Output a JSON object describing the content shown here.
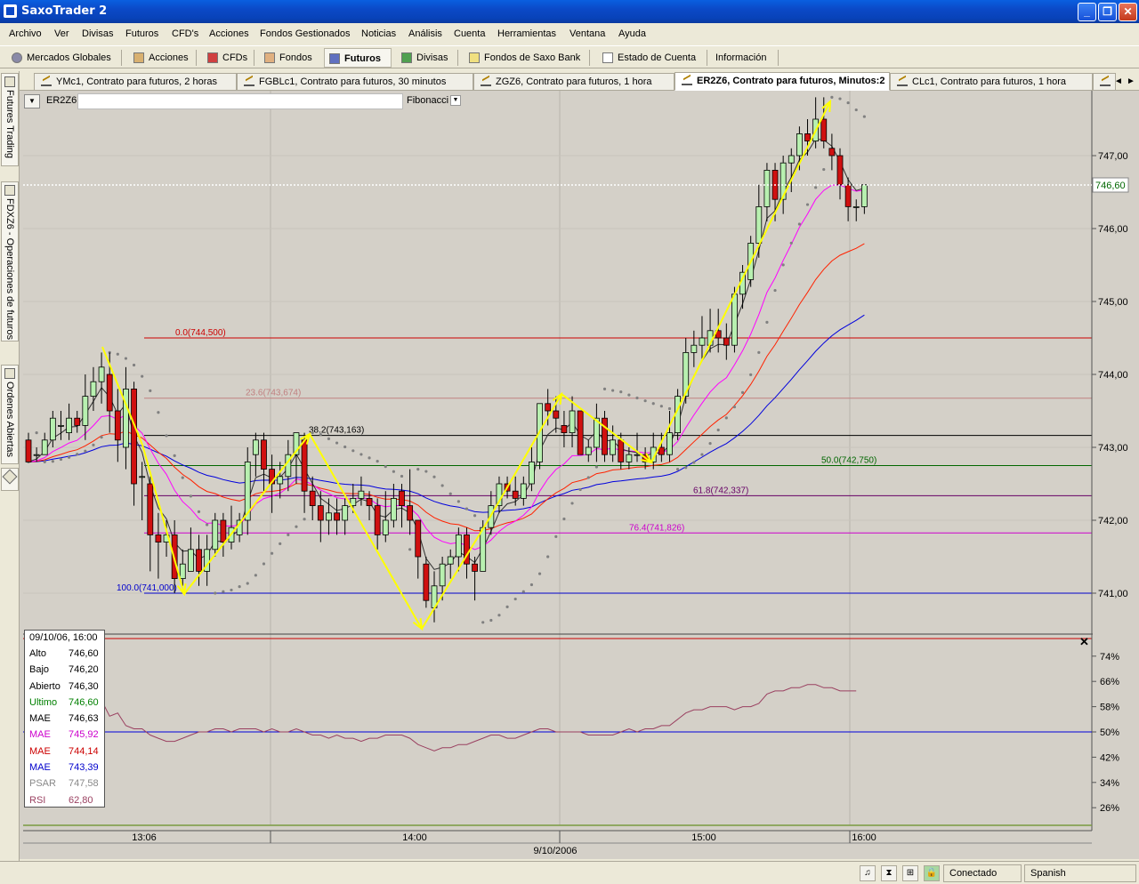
{
  "window": {
    "title": "SaxoTrader 2",
    "minimize": "_",
    "restore": "❐",
    "close": "✕"
  },
  "menu": [
    "Archivo",
    "Ver",
    "Divisas",
    "Futuros",
    "CFD's",
    "Acciones",
    "Fondos Gestionados",
    "Noticias",
    "Análisis",
    "Cuenta",
    "Herramientas",
    "Ventana",
    "Ayuda"
  ],
  "toolbar": [
    "Mercados Globales",
    "Acciones",
    "CFDs",
    "Fondos",
    "Futuros",
    "Divisas",
    "Fondos de Saxo Bank",
    "Estado de Cuenta",
    "Información"
  ],
  "toolbar_active": "Futuros",
  "side_tabs": [
    "Futures Trading",
    "FDXZ6 - Operaciones de futuros",
    "Ordenes Abiertas"
  ],
  "chart_tabs": [
    "YMc1, Contrato para futuros, 2 horas",
    "FGBLc1, Contrato para futuros, 30 minutos",
    "ZGZ6, Contrato para futuros, 1 hora",
    "ER2Z6, Contrato para futuros, Minutos:2",
    "CLc1, Contrato para futuros, 1 hora"
  ],
  "chart_tab_nav": {
    "left": "◄",
    "right": "►"
  },
  "active_chart_tab": 3,
  "chart_header": {
    "symbol": "ER2Z6",
    "study": "Fibonacci"
  },
  "colors": {
    "fib_0": "#cc0000",
    "fib_236": "#c08080",
    "fib_382": "#000000",
    "fib_50": "#006600",
    "fib_618": "#660066",
    "fib_764": "#cc00cc",
    "fib_100": "#0000cc",
    "mae_fast": "#ff00ff",
    "mae_mid": "#ff2200",
    "mae_slow": "#0000dd",
    "psar": "#808080",
    "annotations": "#ffff00",
    "rsi": "#9a4060"
  },
  "fib_levels": [
    {
      "label": "0.0(744,500)",
      "price": 744.5
    },
    {
      "label": "23.6(743,674)",
      "price": 743.674
    },
    {
      "label": "38.2(743,163)",
      "price": 743.163
    },
    {
      "label": "50.0(742,750)",
      "price": 742.75
    },
    {
      "label": "61.8(742,337)",
      "price": 742.337
    },
    {
      "label": "76.4(741,826)",
      "price": 741.826
    },
    {
      "label": "100.0(741,000)",
      "price": 741.0
    }
  ],
  "price_axis": [
    "747,00",
    "746,00",
    "745,00",
    "744,00",
    "743,00",
    "742,00",
    "741,00"
  ],
  "last_price": "746,60",
  "rsi_axis": [
    "74%",
    "66%",
    "58%",
    "50%",
    "42%",
    "34%",
    "26%"
  ],
  "rsi_close": "✕",
  "time_axis": [
    "13:06",
    "14:00",
    "15:00",
    "16:00"
  ],
  "date_label": "9/10/2006",
  "info": {
    "header": "09/10/06, 16:00",
    "rows": [
      {
        "k": "Alto",
        "v": "746,60",
        "color": "#000000"
      },
      {
        "k": "Bajo",
        "v": "746,20",
        "color": "#000000"
      },
      {
        "k": "Abierto",
        "v": "746,30",
        "color": "#000000"
      },
      {
        "k": "Ultimo",
        "v": "746,60",
        "color": "#008000"
      },
      {
        "k": "MAE",
        "v": "746,63",
        "color": "#000000"
      },
      {
        "k": "MAE",
        "v": "745,92",
        "color": "#cc00cc"
      },
      {
        "k": "MAE",
        "v": "744,14",
        "color": "#cc0000"
      },
      {
        "k": "MAE",
        "v": "743,39",
        "color": "#0000cc"
      },
      {
        "k": "PSAR",
        "v": "747,58",
        "color": "#888888"
      },
      {
        "k": "RSI",
        "v": "62,80",
        "color": "#9a4060"
      }
    ]
  },
  "status": {
    "connection": "Conectado",
    "language": "Spanish"
  },
  "chart_data": {
    "type": "candlestick",
    "symbol": "ER2Z6",
    "interval": "2 minutes",
    "y_range": [
      740.4,
      747.8
    ],
    "candles": [
      [
        743.1,
        742.8,
        743.2,
        742.8
      ],
      [
        742.9,
        742.9,
        743.0,
        742.8
      ],
      [
        742.9,
        743.1,
        743.2,
        742.9
      ],
      [
        743.1,
        743.4,
        743.5,
        743.0
      ],
      [
        743.3,
        743.3,
        743.5,
        743.1
      ],
      [
        743.2,
        743.4,
        743.6,
        743.1
      ],
      [
        743.4,
        743.3,
        743.5,
        743.2
      ],
      [
        743.3,
        743.7,
        744.0,
        743.1
      ],
      [
        743.7,
        743.9,
        744.1,
        743.5
      ],
      [
        743.9,
        744.1,
        744.3,
        743.6
      ],
      [
        744.0,
        743.5,
        744.3,
        743.2
      ],
      [
        743.5,
        743.1,
        743.8,
        742.8
      ],
      [
        743.0,
        743.8,
        744.1,
        742.7
      ],
      [
        743.8,
        742.5,
        743.9,
        742.2
      ],
      [
        742.6,
        742.6,
        742.8,
        742.0
      ],
      [
        742.5,
        741.8,
        742.6,
        741.3
      ],
      [
        741.8,
        741.7,
        742.1,
        741.2
      ],
      [
        741.7,
        741.8,
        742.0,
        741.5
      ],
      [
        741.8,
        741.2,
        742.0,
        741.0
      ],
      [
        741.2,
        741.4,
        741.6,
        741.1
      ],
      [
        741.3,
        741.6,
        741.9,
        741.3
      ],
      [
        741.6,
        741.3,
        741.8,
        741.1
      ],
      [
        741.3,
        741.6,
        741.8,
        741.1
      ],
      [
        741.6,
        742.0,
        742.1,
        741.5
      ],
      [
        742.0,
        741.7,
        742.1,
        741.5
      ],
      [
        741.7,
        741.9,
        742.2,
        741.6
      ],
      [
        741.8,
        742.0,
        742.1,
        741.7
      ],
      [
        742.0,
        742.8,
        743.0,
        741.8
      ],
      [
        742.9,
        743.1,
        743.2,
        742.6
      ],
      [
        743.1,
        742.7,
        743.2,
        742.4
      ],
      [
        742.7,
        742.5,
        742.9,
        742.1
      ],
      [
        742.5,
        742.6,
        742.8,
        742.3
      ],
      [
        742.6,
        742.9,
        743.1,
        742.4
      ],
      [
        742.9,
        743.2,
        743.2,
        742.5
      ],
      [
        743.1,
        742.4,
        743.2,
        742.1
      ],
      [
        742.4,
        742.2,
        742.6,
        742.0
      ],
      [
        742.2,
        742.0,
        742.4,
        741.7
      ],
      [
        742.0,
        742.1,
        742.3,
        741.8
      ],
      [
        742.1,
        742.0,
        742.3,
        741.8
      ],
      [
        742.0,
        742.2,
        742.3,
        741.8
      ],
      [
        742.2,
        742.3,
        742.5,
        742.1
      ],
      [
        742.3,
        742.4,
        742.6,
        742.2
      ],
      [
        742.3,
        742.2,
        742.4,
        742.0
      ],
      [
        742.2,
        741.8,
        742.3,
        741.6
      ],
      [
        741.8,
        742.0,
        742.4,
        741.7
      ],
      [
        742.0,
        742.3,
        742.5,
        741.9
      ],
      [
        742.4,
        742.2,
        742.5,
        741.9
      ],
      [
        742.2,
        742.0,
        742.7,
        741.8
      ],
      [
        742.0,
        741.5,
        742.0,
        741.2
      ],
      [
        741.4,
        740.9,
        741.5,
        740.8
      ],
      [
        740.8,
        741.1,
        741.3,
        740.6
      ],
      [
        741.1,
        741.4,
        741.5,
        740.9
      ],
      [
        741.4,
        741.5,
        741.6,
        741.2
      ],
      [
        741.5,
        741.8,
        741.9,
        741.3
      ],
      [
        741.8,
        741.4,
        741.9,
        741.2
      ],
      [
        741.4,
        741.3,
        741.5,
        740.9
      ],
      [
        741.3,
        741.9,
        742.0,
        741.3
      ],
      [
        741.9,
        742.2,
        742.4,
        741.8
      ],
      [
        742.2,
        742.5,
        742.6,
        742.1
      ],
      [
        742.5,
        742.4,
        742.6,
        742.3
      ],
      [
        742.4,
        742.3,
        742.6,
        742.2
      ],
      [
        742.3,
        742.5,
        742.6,
        742.2
      ],
      [
        742.5,
        742.8,
        743.0,
        742.4
      ],
      [
        742.8,
        743.6,
        743.6,
        742.7
      ],
      [
        743.6,
        743.5,
        743.8,
        743.3
      ],
      [
        743.5,
        743.4,
        743.7,
        743.2
      ],
      [
        743.3,
        743.2,
        743.5,
        743.0
      ],
      [
        743.2,
        743.5,
        743.7,
        743.0
      ],
      [
        743.5,
        742.9,
        743.5,
        742.9
      ],
      [
        742.9,
        743.0,
        743.1,
        742.8
      ],
      [
        743.0,
        743.4,
        743.6,
        742.8
      ],
      [
        743.4,
        742.9,
        743.5,
        742.8
      ],
      [
        742.9,
        743.1,
        743.3,
        742.8
      ],
      [
        743.1,
        742.8,
        743.2,
        742.7
      ],
      [
        742.8,
        742.9,
        743.0,
        742.7
      ],
      [
        742.9,
        742.9,
        743.2,
        742.8
      ],
      [
        742.9,
        742.8,
        743.0,
        742.7
      ],
      [
        742.8,
        743.0,
        743.2,
        742.7
      ],
      [
        743.0,
        742.9,
        743.2,
        742.8
      ],
      [
        742.9,
        743.2,
        743.5,
        742.8
      ],
      [
        743.2,
        743.7,
        743.8,
        743.1
      ],
      [
        743.7,
        744.3,
        744.5,
        743.6
      ],
      [
        744.3,
        744.4,
        744.6,
        744.1
      ],
      [
        744.4,
        744.5,
        744.8,
        744.2
      ],
      [
        744.4,
        744.6,
        744.9,
        744.3
      ],
      [
        744.6,
        744.5,
        744.9,
        744.3
      ],
      [
        744.5,
        744.4,
        744.7,
        744.2
      ],
      [
        744.4,
        745.1,
        745.2,
        744.3
      ],
      [
        745.1,
        745.4,
        745.5,
        744.9
      ],
      [
        745.3,
        745.8,
        745.9,
        745.2
      ],
      [
        745.8,
        746.3,
        746.6,
        745.6
      ],
      [
        746.3,
        746.8,
        746.9,
        746.1
      ],
      [
        746.8,
        746.4,
        746.9,
        746.1
      ],
      [
        746.4,
        746.9,
        747.0,
        746.2
      ],
      [
        746.9,
        747.0,
        747.1,
        746.5
      ],
      [
        747.0,
        747.3,
        747.4,
        746.8
      ],
      [
        747.3,
        747.2,
        747.5,
        747.0
      ],
      [
        747.2,
        747.5,
        747.8,
        747.1
      ],
      [
        747.5,
        747.2,
        747.8,
        747.1
      ],
      [
        747.1,
        747.0,
        747.3,
        746.8
      ],
      [
        747.0,
        746.6,
        747.1,
        746.4
      ],
      [
        746.6,
        746.3,
        746.7,
        746.1
      ],
      [
        746.3,
        746.3,
        746.4,
        746.1
      ],
      [
        746.3,
        746.6,
        746.6,
        746.2
      ]
    ],
    "rsi": [
      57,
      57,
      55,
      57,
      59,
      59,
      58,
      60,
      62,
      60,
      55,
      56,
      52,
      51,
      51,
      49,
      48,
      47,
      47,
      48,
      49,
      50,
      50,
      51,
      51,
      50,
      51,
      51,
      51,
      50,
      51,
      50,
      50,
      51,
      50,
      49,
      49,
      48,
      49,
      48,
      48,
      47,
      48,
      48,
      49,
      49,
      49,
      48,
      46,
      45,
      44,
      45,
      45,
      46,
      46,
      47,
      48,
      49,
      49,
      48,
      48,
      49,
      50,
      51,
      51,
      50,
      50,
      50,
      50,
      49,
      49,
      49,
      49,
      50,
      51,
      50,
      51,
      51,
      52,
      52,
      54,
      56,
      57,
      57,
      58,
      58,
      58,
      57,
      58,
      58,
      59,
      62,
      63,
      63,
      64,
      64,
      65,
      65,
      64,
      64,
      63,
      63,
      63
    ]
  }
}
